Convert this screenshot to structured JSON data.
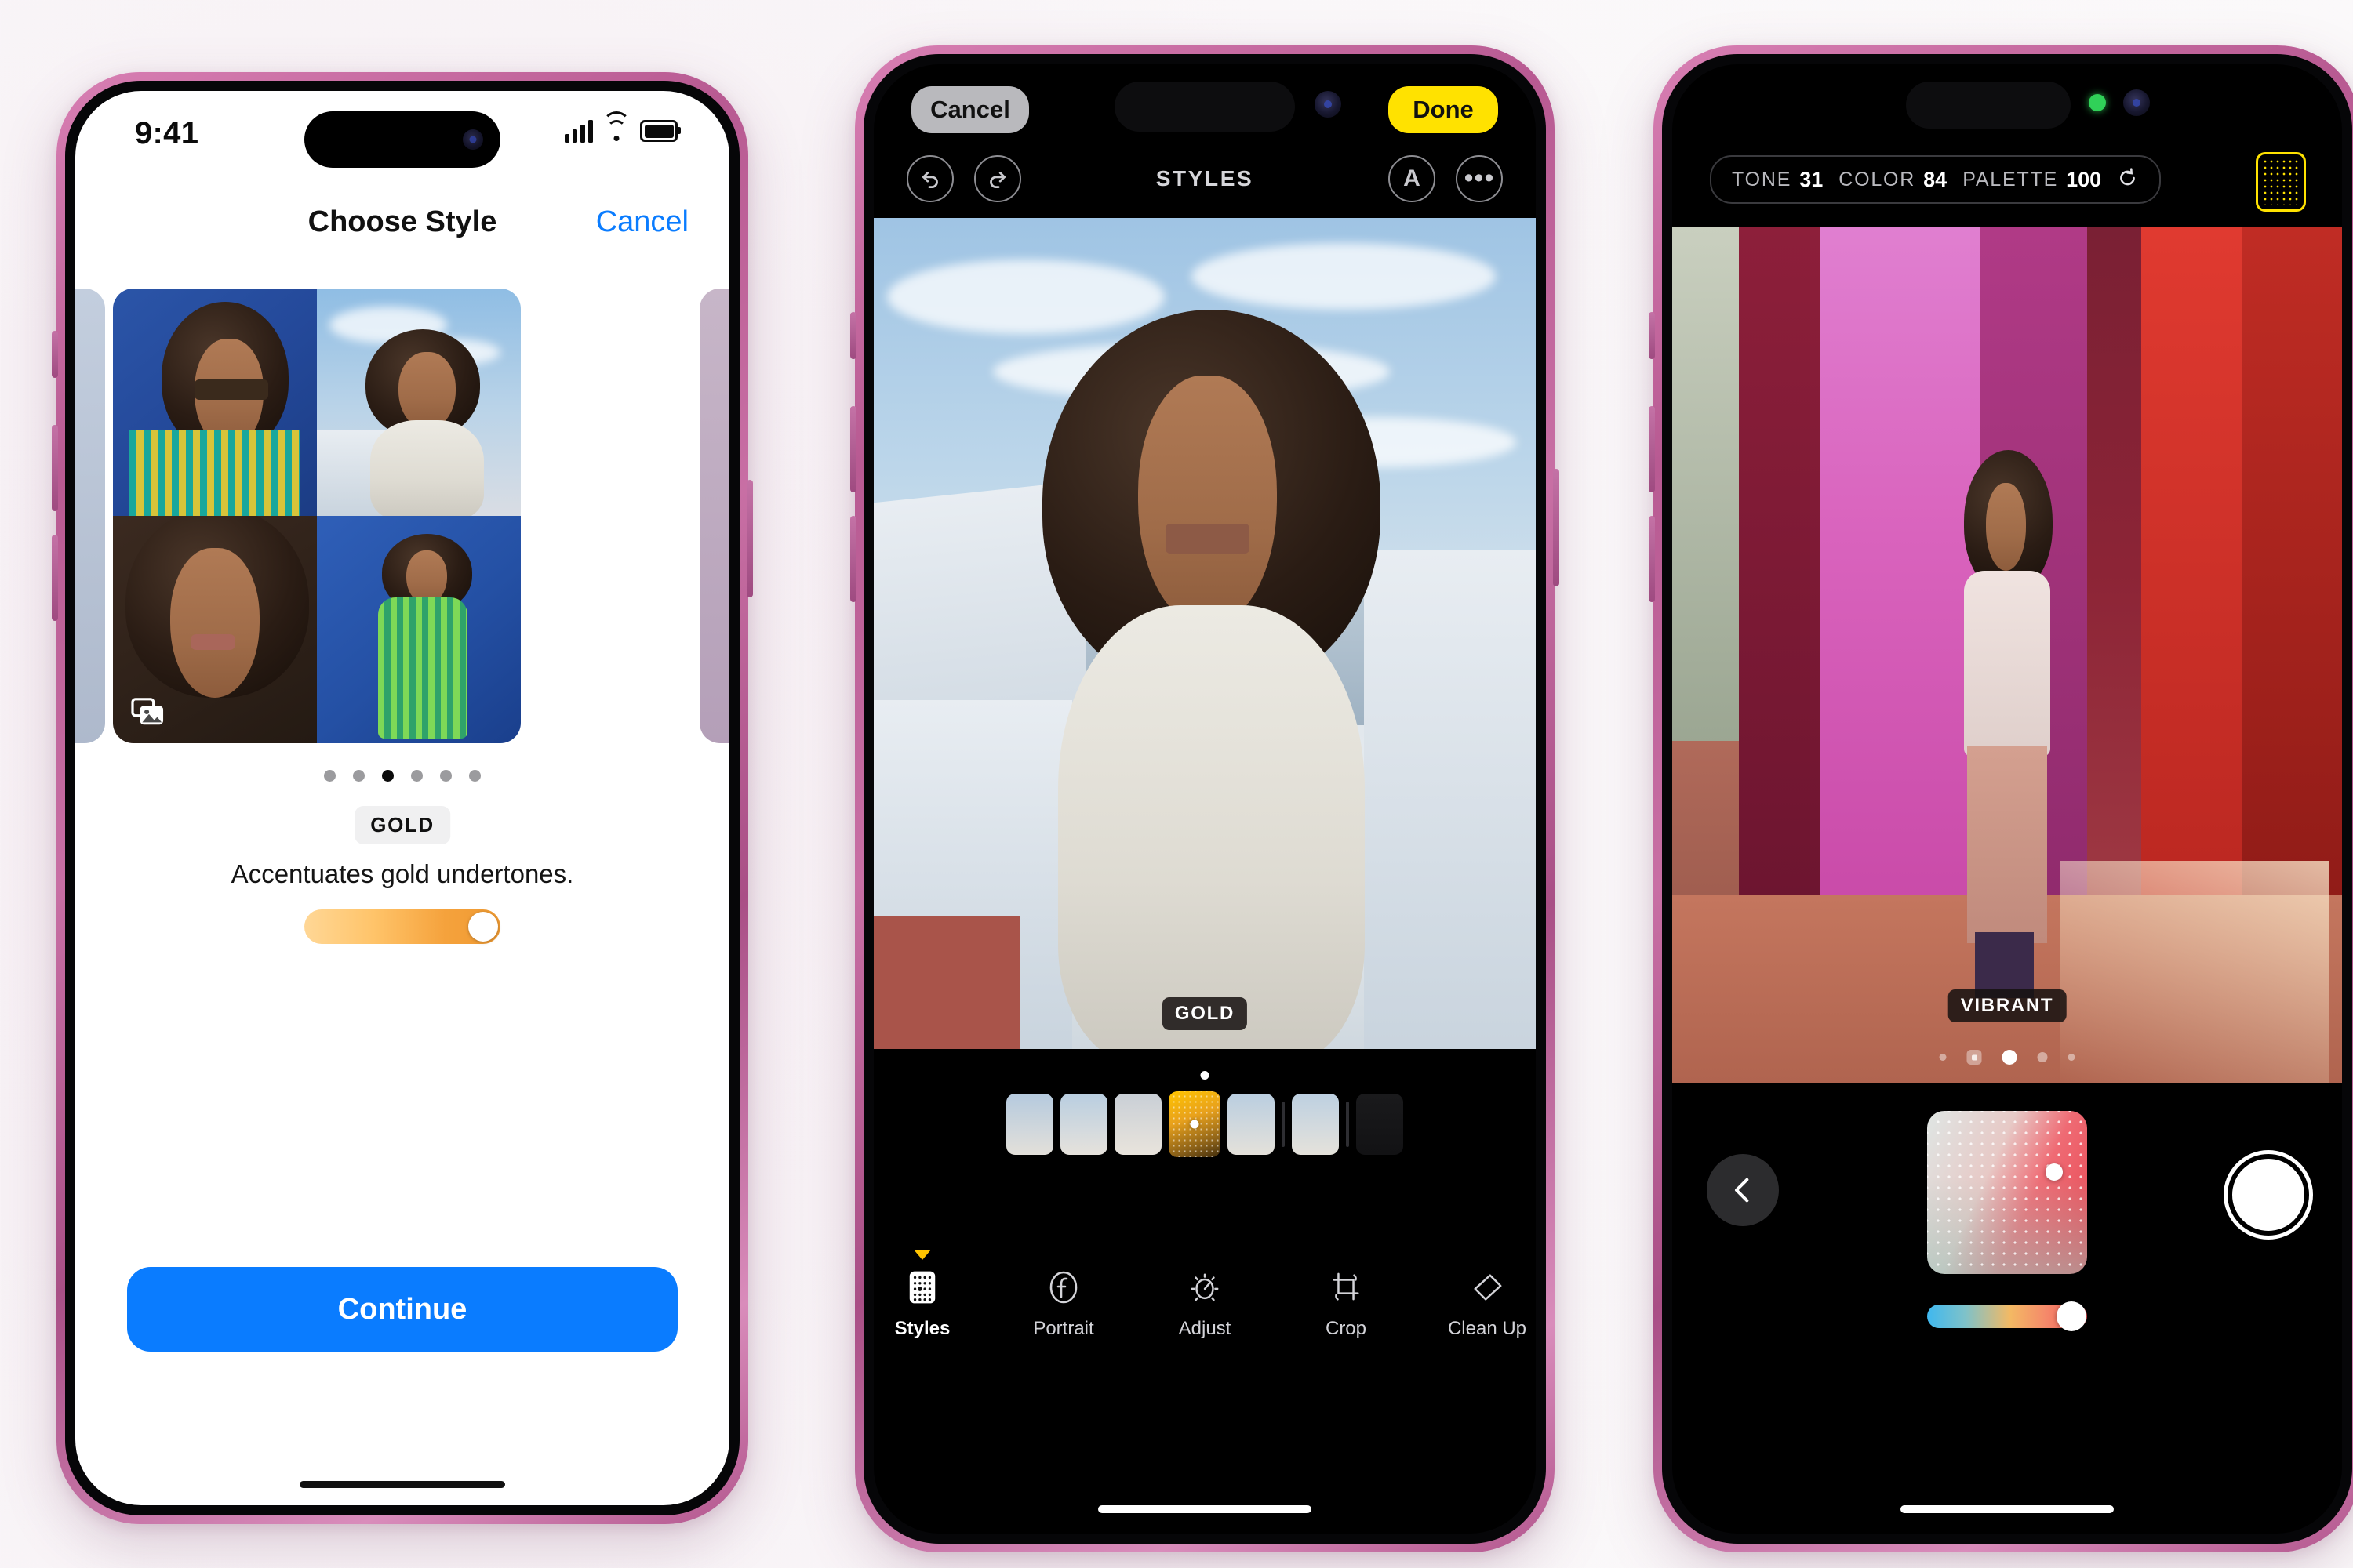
{
  "phone1": {
    "status": {
      "time": "9:41",
      "signal_icon": "cellular-bars-icon",
      "wifi_icon": "wifi-icon",
      "battery_icon": "battery-icon"
    },
    "navbar": {
      "title": "Choose Style",
      "cancel_label": "Cancel"
    },
    "grid": {
      "badge_icon": "stacked-photos-icon",
      "tiles": 4
    },
    "pager": {
      "count": 6,
      "active_index": 2
    },
    "style": {
      "name": "GOLD",
      "caption": "Accentuates gold undertones.",
      "slider_value": 92,
      "slider_color_start": "#ffd796",
      "slider_color_end": "#ef9a32"
    },
    "cta": {
      "label": "Continue",
      "color": "#0a7cff"
    }
  },
  "phone2": {
    "topbar": {
      "cancel_label": "Cancel",
      "done_label": "Done",
      "done_color": "#ffe200"
    },
    "toolbar": {
      "title": "STYLES",
      "undo_icon": "undo-icon",
      "redo_icon": "redo-icon",
      "auto_icon": "auto-enhance-icon",
      "more_icon": "more-options-icon"
    },
    "photo": {
      "overlay_badge": "GOLD"
    },
    "thumbstrip": {
      "count": 7,
      "selected_index": 3
    },
    "tabs": [
      {
        "label": "Styles",
        "icon": "styles-grid-icon",
        "active": true
      },
      {
        "label": "Portrait",
        "icon": "portrait-f-icon",
        "active": false
      },
      {
        "label": "Adjust",
        "icon": "adjust-dial-icon",
        "active": false
      },
      {
        "label": "Crop",
        "icon": "crop-icon",
        "active": false
      },
      {
        "label": "Clean Up",
        "icon": "eraser-icon",
        "active": false
      }
    ]
  },
  "phone3": {
    "hud": {
      "tone_label": "TONE",
      "tone_value": "31",
      "color_label": "COLOR",
      "color_value": "84",
      "palette_label": "PALETTE",
      "palette_value": "100",
      "reset_icon": "reset-arrow-icon",
      "grid_button_icon": "styles-grid-icon",
      "grid_button_color": "#ffe200"
    },
    "photo": {
      "overlay_badge": "VIBRANT"
    },
    "pager": {
      "count": 5,
      "active_index": 2
    },
    "controls": {
      "back_icon": "chevron-left-icon",
      "shutter_icon": "shutter-button",
      "color_pad_icon": "color-pad",
      "hue_slider_value": 96
    },
    "status": {
      "camera_active_dot": "green-recording-dot"
    }
  }
}
